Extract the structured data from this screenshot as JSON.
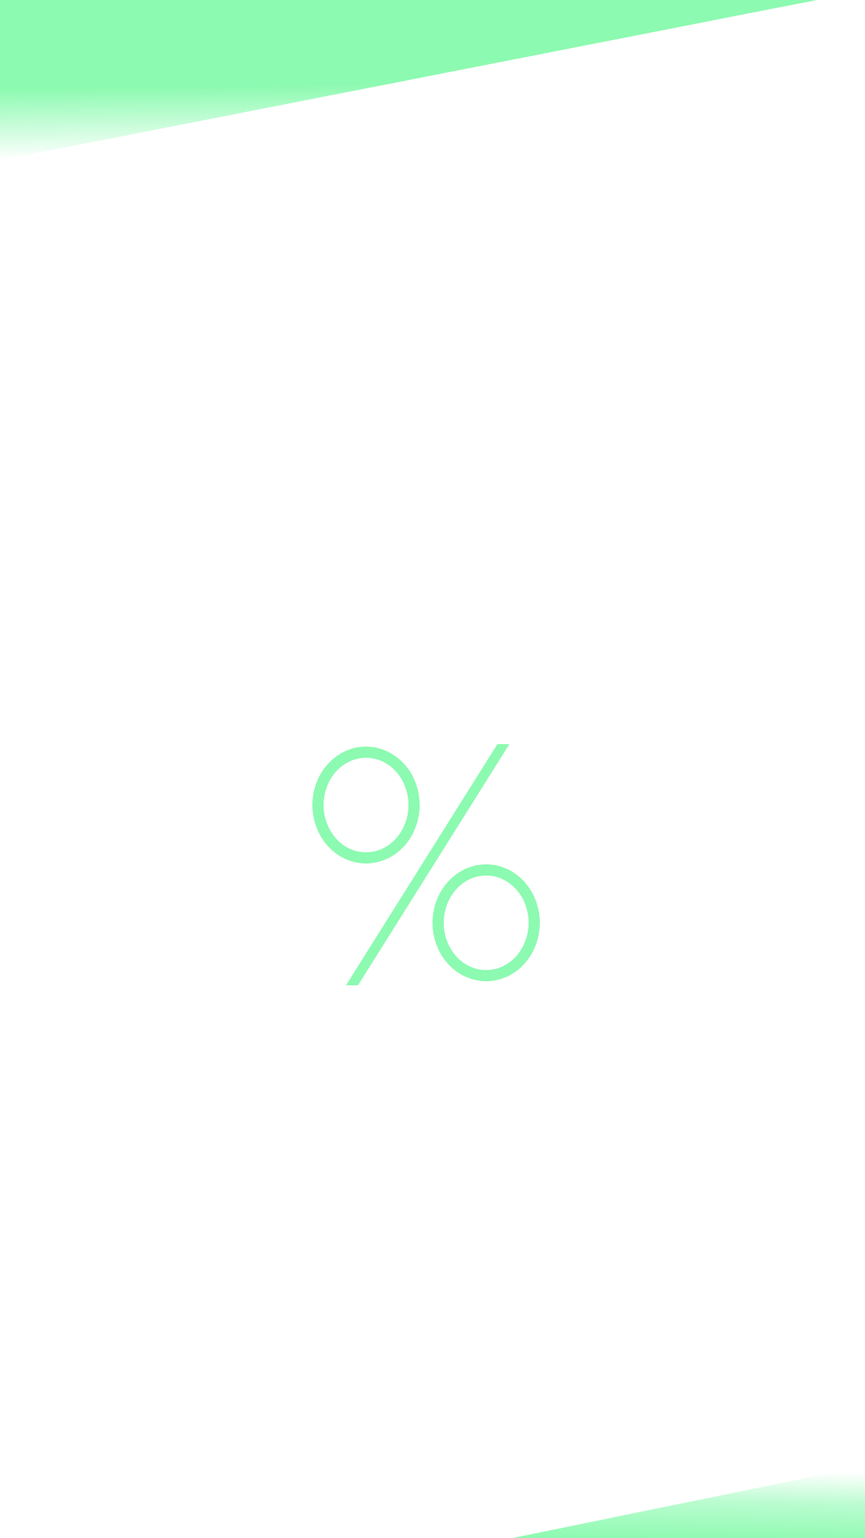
{
  "screen": {
    "symbol": "%",
    "icon": "percent-icon"
  },
  "colors": {
    "accent": "#8cfab0",
    "background": "#ffffff"
  }
}
